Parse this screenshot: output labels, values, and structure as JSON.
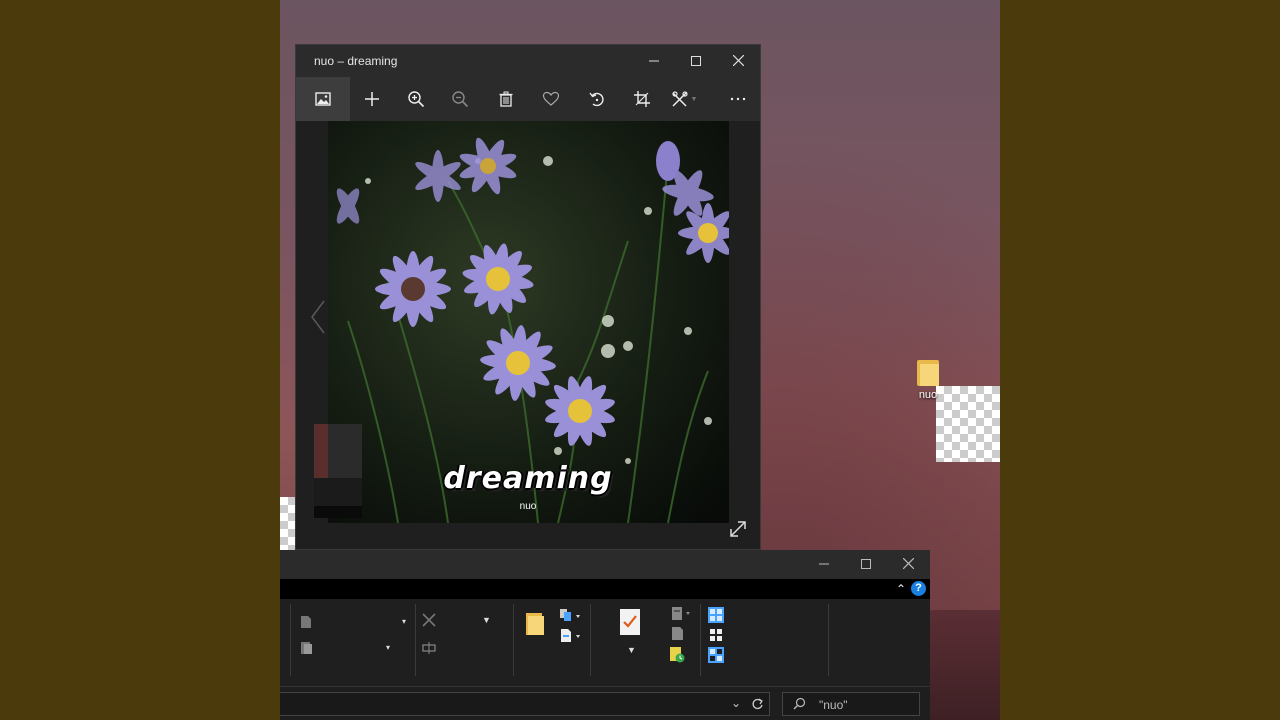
{
  "desktop": {
    "folder_label": "nuo"
  },
  "photos": {
    "title": "nuo – dreaming",
    "toolbar": [
      "picture-icon",
      "add-icon",
      "zoom-in-icon",
      "zoom-out-icon",
      "delete-icon",
      "favorite-icon",
      "rotate-icon",
      "crop-icon",
      "edit-icon",
      "more-icon"
    ],
    "artwork": {
      "title_text": "dreaming",
      "artist_text": "nuo"
    },
    "colors": {
      "background": "#1f1f1f",
      "toolbar": "#2b2b2b",
      "active": "#3d3d3d"
    }
  },
  "explorer": {
    "search_placeholder": "\"nuo\"",
    "help_label": "?",
    "colors": {
      "accent": "#1a7fe0"
    }
  }
}
